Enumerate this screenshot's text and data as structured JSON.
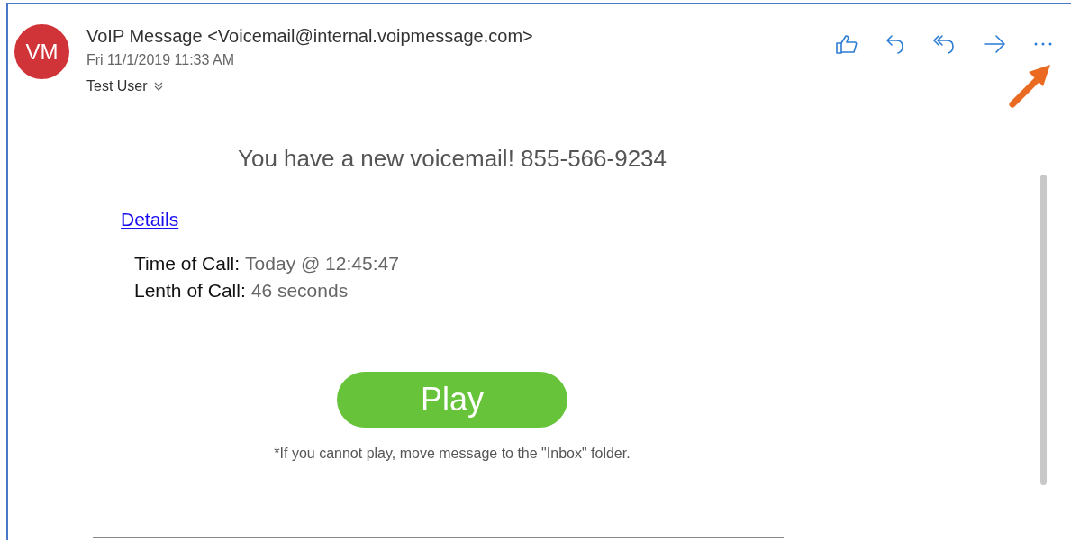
{
  "header": {
    "avatar_initials": "VM",
    "sender": "VoIP Message <Voicemail@internal.voipmessage.com>",
    "date": "Fri 11/1/2019 11:33 AM",
    "recipient": "Test User"
  },
  "toolbar": [
    {
      "kind": "like"
    },
    {
      "kind": "reply"
    },
    {
      "kind": "reply-all"
    },
    {
      "kind": "forward"
    },
    {
      "kind": "more"
    }
  ],
  "body": {
    "heading": "You have a new voicemail! 855-566-9234",
    "link": "Details",
    "fields": [
      {
        "label": "Time of Call:",
        "value": "Today @ 12:45:47"
      },
      {
        "label": "Lenth of Call:",
        "value": "46 seconds"
      }
    ],
    "play_button": "Play",
    "footnote": "*If you cannot play, move message to the \"Inbox\" folder."
  }
}
